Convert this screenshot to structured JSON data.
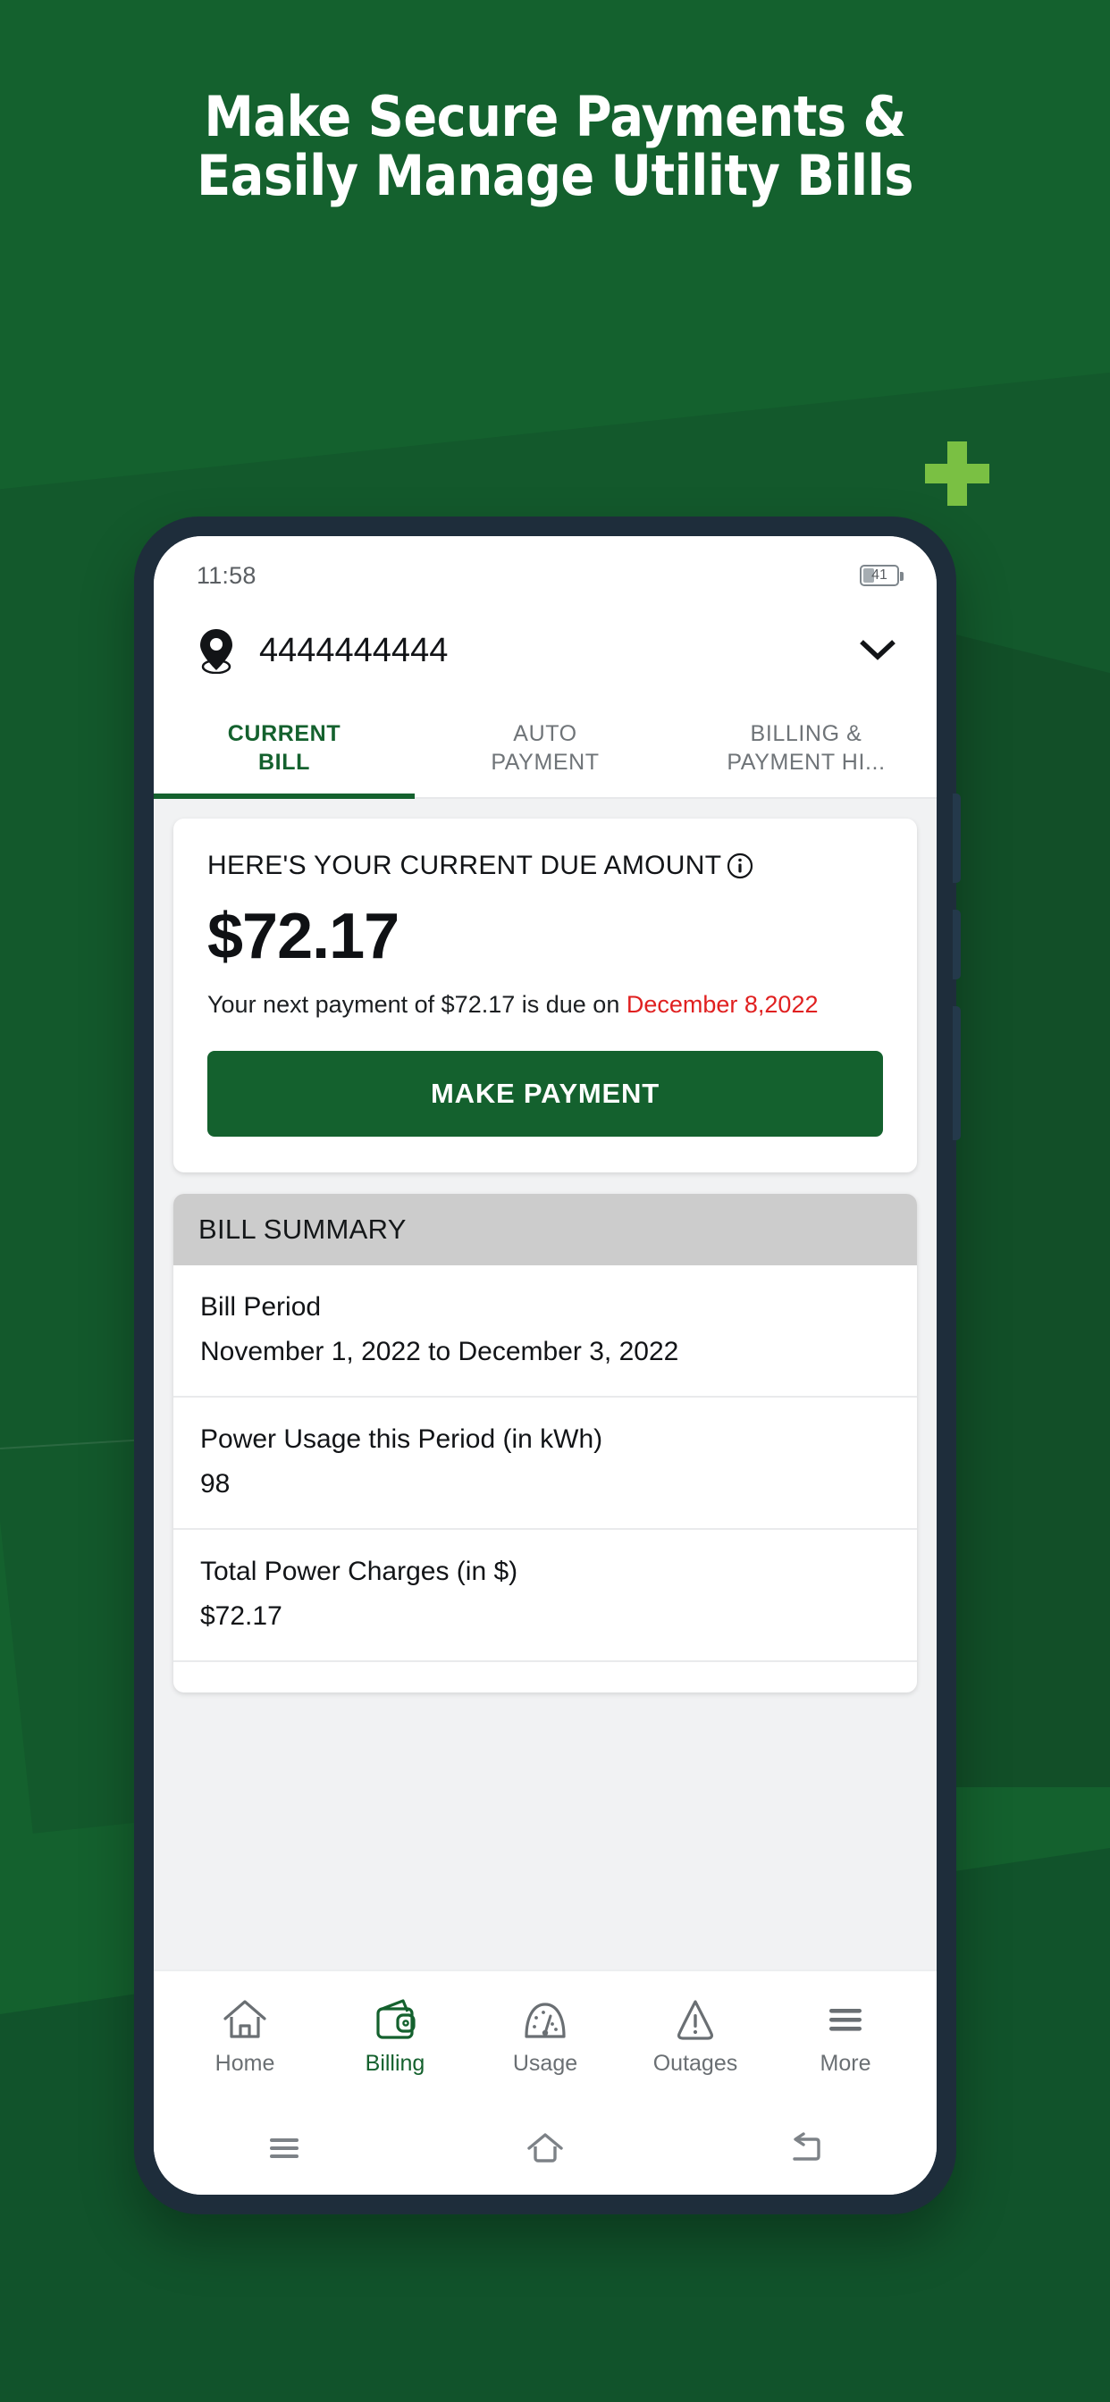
{
  "promo": {
    "headline_line1": "Make Secure Payments &",
    "headline_line2": "Easily Manage Utility Bills",
    "accent_color": "#7ac043",
    "background_color": "#14612e"
  },
  "status_bar": {
    "time": "11:58",
    "battery_level": "41"
  },
  "account_header": {
    "account_number": "4444444444",
    "location_icon": "location-pin-icon",
    "dropdown_icon": "chevron-down-icon"
  },
  "tabs": [
    {
      "label": "CURRENT\nBILL",
      "active": true
    },
    {
      "label": "AUTO\nPAYMENT",
      "active": false
    },
    {
      "label": "BILLING &\nPAYMENT HI...",
      "active": false
    }
  ],
  "due_card": {
    "title": "HERE'S YOUR CURRENT DUE AMOUNT",
    "info_icon": "info-circle-icon",
    "amount": "$72.17",
    "sub_prefix": "Your next payment of $72.17 is due on ",
    "sub_date": "December 8,2022",
    "date_color": "#e02020",
    "button_label": "MAKE PAYMENT",
    "button_color": "#14612e"
  },
  "bill_summary": {
    "header": "BILL SUMMARY",
    "rows": [
      {
        "label": "Bill Period",
        "value": "November 1, 2022 to December 3, 2022"
      },
      {
        "label": "Power Usage this Period (in kWh)",
        "value": "98"
      },
      {
        "label": "Total Power Charges (in $)",
        "value": "$72.17"
      }
    ]
  },
  "bottom_nav": [
    {
      "label": "Home",
      "icon": "home-icon",
      "active": false
    },
    {
      "label": "Billing",
      "icon": "wallet-icon",
      "active": true
    },
    {
      "label": "Usage",
      "icon": "gauge-icon",
      "active": false
    },
    {
      "label": "Outages",
      "icon": "warning-triangle-icon",
      "active": false
    },
    {
      "label": "More",
      "icon": "hamburger-icon",
      "active": false
    }
  ],
  "system_nav": [
    {
      "icon": "recents-icon"
    },
    {
      "icon": "home-outline-icon"
    },
    {
      "icon": "back-arrow-icon"
    }
  ]
}
